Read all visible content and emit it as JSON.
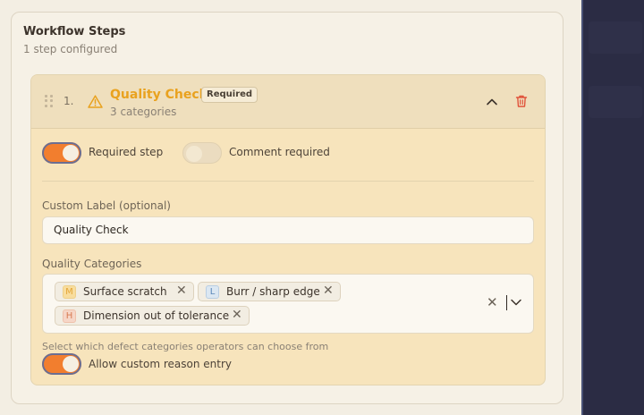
{
  "section": {
    "title": "Workflow Steps",
    "subtitle": "1 step configured"
  },
  "step": {
    "number": "1.",
    "title": "Quality Check",
    "badge": "Required",
    "subtitle": "3 categories",
    "icons": {
      "drag": "drag-handle-icon",
      "warning": "warning-icon",
      "collapse": "chevron-up-icon",
      "delete": "trash-icon"
    },
    "toggles": {
      "required_step": {
        "label": "Required step",
        "on": true
      },
      "comment_required": {
        "label": "Comment required",
        "on": false
      },
      "allow_custom": {
        "label": "Allow custom reason entry",
        "on": true
      }
    },
    "custom_label": {
      "label": "Custom Label (optional)",
      "value": "Quality Check"
    },
    "categories": {
      "label": "Quality Categories",
      "selected": [
        {
          "level": "M",
          "name": "Surface scratch"
        },
        {
          "level": "L",
          "name": "Burr / sharp edge"
        },
        {
          "level": "H",
          "name": "Dimension out of tolerance"
        }
      ],
      "hint": "Select which defect categories operators can choose from"
    }
  },
  "colors": {
    "accent": "#f27e2e",
    "warning": "#e9a21f",
    "danger": "#e0523a"
  }
}
